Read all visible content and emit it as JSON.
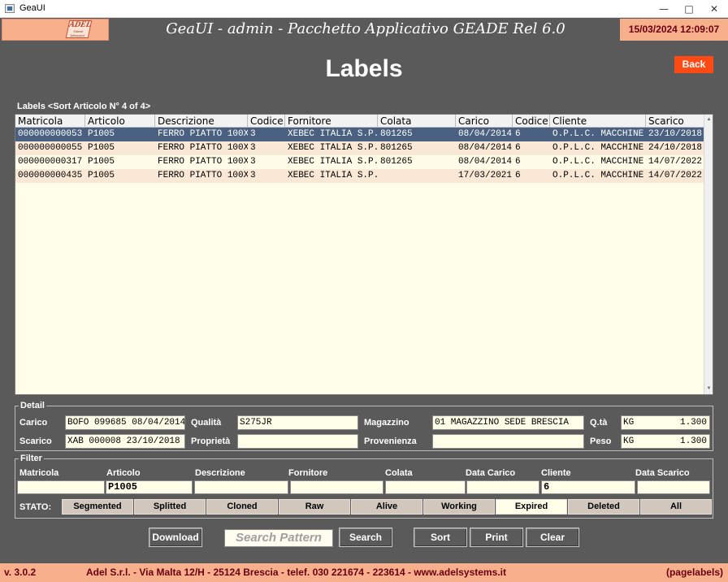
{
  "window": {
    "title": "GeaUI",
    "minimize": "—",
    "maximize": "□",
    "close": "✕"
  },
  "header": {
    "logo_text": "ADEL",
    "logo_sub": "Sistemi Informatici",
    "app_title": "GeaUI - admin - Pacchetto Applicativo GEADE Rel 6.0",
    "datetime": "15/03/2024 12:09:07"
  },
  "page": {
    "title": "Labels",
    "back_label": "Back"
  },
  "list": {
    "caption": "Labels <Sort Articolo N° 4 of 4>",
    "columns": [
      "Matricola",
      "Articolo",
      "Descrizione",
      "Codice",
      "Fornitore",
      "Colata",
      "Carico",
      "Codice",
      "Cliente",
      "Scarico"
    ],
    "rows": [
      [
        "000000000053",
        "P1005",
        "FERRO PIATTO 100X",
        "3",
        "XEBEC ITALIA S.P.",
        "801265",
        "08/04/2014",
        "6",
        "O.P.L.C. MACCHINE",
        "23/10/2018"
      ],
      [
        "000000000055",
        "P1005",
        "FERRO PIATTO 100X",
        "3",
        "XEBEC ITALIA S.P.",
        "801265",
        "08/04/2014",
        "6",
        "O.P.L.C. MACCHINE",
        "24/10/2018"
      ],
      [
        "000000000317",
        "P1005",
        "FERRO PIATTO 100X",
        "3",
        "XEBEC ITALIA S.P.",
        "801265",
        "08/04/2014",
        "6",
        "O.P.L.C. MACCHINE",
        "14/07/2022"
      ],
      [
        "000000000435",
        "P1005",
        "FERRO PIATTO 100X",
        "3",
        "XEBEC ITALIA S.P.",
        "",
        "17/03/2021",
        "6",
        "O.P.L.C. MACCHINE",
        "14/07/2022"
      ]
    ],
    "selected_row": 0,
    "scroll_up": "▲",
    "scroll_down": "▼"
  },
  "detail": {
    "legend": "Detail",
    "carico_label": "Carico",
    "carico_value": "BOFO 099685 08/04/2014",
    "scarico_label": "Scarico",
    "scarico_value": "XAB  000008 23/10/2018",
    "qualita_label": "Qualità",
    "qualita_value": "S275JR",
    "proprieta_label": "Proprietà",
    "proprieta_value": "",
    "magazzino_label": "Magazzino",
    "magazzino_value": "01 MAGAZZINO SEDE BRESCIA",
    "provenienza_label": "Provenienza",
    "provenienza_value": "",
    "qta_label": "Q.tà",
    "qta_unit": "KG",
    "qta_value": "1.300",
    "peso_label": "Peso",
    "peso_unit": "KG",
    "peso_value": "1.300"
  },
  "filter": {
    "legend": "Filter",
    "fields": [
      {
        "label": "Matricola",
        "value": ""
      },
      {
        "label": "Articolo",
        "value": "P1005"
      },
      {
        "label": "Descrizione",
        "value": ""
      },
      {
        "label": "Fornitore",
        "value": ""
      },
      {
        "label": "Colata",
        "value": ""
      },
      {
        "label": "Data Carico",
        "value": ""
      },
      {
        "label": "Cliente",
        "value": "6"
      },
      {
        "label": "Data Scarico",
        "value": ""
      }
    ],
    "stato_label": "STATO:",
    "stato": [
      "Segmented",
      "Splitted",
      "Cloned",
      "Raw",
      "Alive",
      "Working",
      "Expired",
      "Deleted",
      "All"
    ],
    "stato_active": "Expired"
  },
  "actions": {
    "download": "Download",
    "search_pattern": "Search Pattern",
    "search": "Search",
    "sort": "Sort",
    "print": "Print",
    "clear": "Clear"
  },
  "footer": {
    "version": "v. 3.0.2",
    "company": "Adel S.r.l. - Via Malta 12/H - 25124 Brescia - telef. 030 221674 - 223614 - www.adelsystems.it",
    "page_id": "(pagelabels)"
  },
  "colors": {
    "accent": "#ff4a14",
    "selected_row": "#4a6080",
    "panel": "#5a5a5a",
    "band": "#f7b08b"
  }
}
